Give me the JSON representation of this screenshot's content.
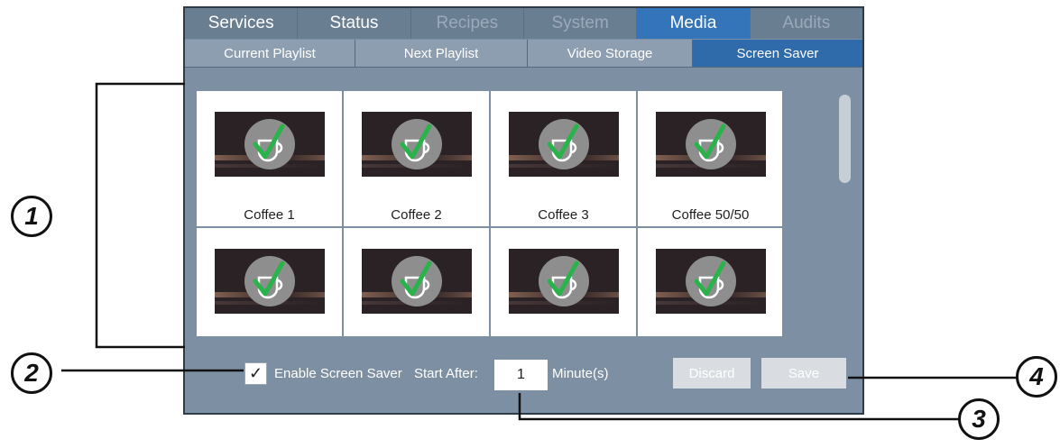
{
  "tabs": [
    {
      "label": "Services",
      "state": "normal"
    },
    {
      "label": "Status",
      "state": "normal"
    },
    {
      "label": "Recipes",
      "state": "disabled"
    },
    {
      "label": "System",
      "state": "disabled"
    },
    {
      "label": "Media",
      "state": "active"
    },
    {
      "label": "Audits",
      "state": "disabled"
    }
  ],
  "subtabs": [
    {
      "label": "Current Playlist"
    },
    {
      "label": "Next Playlist"
    },
    {
      "label": "Video Storage"
    },
    {
      "label": "Screen Saver",
      "active": true
    }
  ],
  "thumbnails": [
    {
      "label": "Coffee 1"
    },
    {
      "label": "Coffee 2"
    },
    {
      "label": "Coffee 3"
    },
    {
      "label": "Coffee 50/50"
    },
    {
      "label": ""
    },
    {
      "label": ""
    },
    {
      "label": ""
    },
    {
      "label": ""
    }
  ],
  "settings": {
    "enable_checked": true,
    "checkbox_mark": "✓",
    "enable_label": "Enable Screen Saver",
    "start_after_label": "Start After:",
    "start_after_value": "1",
    "unit_label": "Minute(s)",
    "discard_label": "Discard",
    "save_label": "Save"
  },
  "callouts": [
    "1",
    "2",
    "3",
    "4"
  ],
  "icons": {
    "thumbnail": "coffee-cup-checkmark-icon",
    "checkbox": "checkmark-icon"
  },
  "colors": {
    "screen_bg": "#7d8fa2",
    "active_tab": "#3474b8",
    "active_subtab": "#2f6aab",
    "check_green": "#29b34a"
  }
}
